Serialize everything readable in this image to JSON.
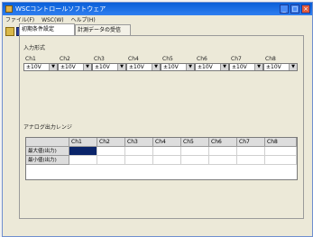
{
  "window": {
    "title": "WSCコントロールソフトウェア"
  },
  "menu": {
    "items": [
      "ファイル(F)",
      "WSC(W)",
      "ヘルプ(H)"
    ]
  },
  "toolbar": {
    "open_icon": "folder-open-icon",
    "save_icon": "floppy-save-icon",
    "export_icon": "export-icon"
  },
  "tabs": [
    {
      "label": "初期条件設定"
    },
    {
      "label": "計測データの受信"
    }
  ],
  "input_section": {
    "label": "入力形式",
    "channels": [
      {
        "label": "Ch1",
        "value": "±10V"
      },
      {
        "label": "Ch2",
        "value": "±10V"
      },
      {
        "label": "Ch3",
        "value": "±10V"
      },
      {
        "label": "Ch4",
        "value": "±10V"
      },
      {
        "label": "Ch5",
        "value": "±10V"
      },
      {
        "label": "Ch6",
        "value": "±10V"
      },
      {
        "label": "Ch7",
        "value": "±10V"
      },
      {
        "label": "Ch8",
        "value": "±10V"
      }
    ]
  },
  "analog_section": {
    "label": "アナログ出力レンジ",
    "columns": [
      "Ch1",
      "Ch2",
      "Ch3",
      "Ch4",
      "Ch5",
      "Ch6",
      "Ch7",
      "Ch8"
    ],
    "rows": [
      {
        "label": "最大値(出力)"
      },
      {
        "label": "最小値(出力)"
      }
    ]
  }
}
